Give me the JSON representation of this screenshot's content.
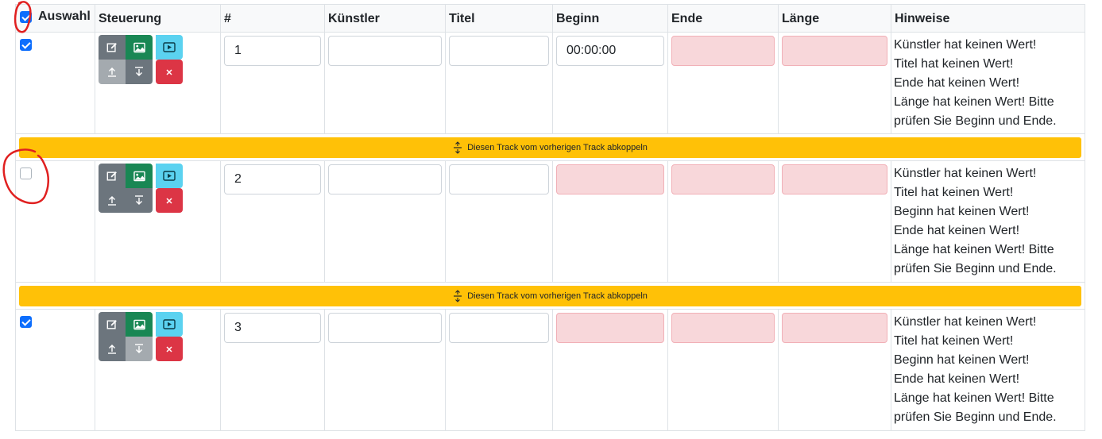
{
  "header": {
    "auswahl": "Auswahl",
    "steuerung": "Steuerung",
    "nummer": "#",
    "kuenstler": "Künstler",
    "titel": "Titel",
    "beginn": "Beginn",
    "ende": "Ende",
    "laenge": "Länge",
    "hinweise": "Hinweise"
  },
  "separator_label": "Diesen Track vom vorherigen Track abkoppeln",
  "tracks": [
    {
      "checked": true,
      "number": "1",
      "kuenstler": "",
      "titel": "",
      "beginn": "00:00:00",
      "ende": "",
      "laenge": "",
      "notes": [
        "Künstler hat keinen Wert!",
        "Titel hat keinen Wert!",
        "Ende hat keinen Wert!",
        "Länge hat keinen Wert! Bitte prüfen Sie Beginn und Ende."
      ]
    },
    {
      "checked": false,
      "number": "2",
      "kuenstler": "",
      "titel": "",
      "beginn": "",
      "ende": "",
      "laenge": "",
      "notes": [
        "Künstler hat keinen Wert!",
        "Titel hat keinen Wert!",
        "Beginn hat keinen Wert!",
        "Ende hat keinen Wert!",
        "Länge hat keinen Wert! Bitte prüfen Sie Beginn und Ende."
      ]
    },
    {
      "checked": true,
      "number": "3",
      "kuenstler": "",
      "titel": "",
      "beginn": "",
      "ende": "",
      "laenge": "",
      "notes": [
        "Künstler hat keinen Wert!",
        "Titel hat keinen Wert!",
        "Beginn hat keinen Wert!",
        "Ende hat keinen Wert!",
        "Länge hat keinen Wert! Bitte prüfen Sie Beginn und Ende."
      ]
    }
  ],
  "icons": {
    "edit": "pencil-square-icon",
    "image": "image-icon",
    "play": "play-icon",
    "up": "arrow-up-icon",
    "down": "arrow-down-icon",
    "delete": "close-icon",
    "separator": "expand-vertical-icon"
  },
  "colors": {
    "primary": "#0d6efd",
    "warning": "#ffc107",
    "danger": "#dc3545",
    "success": "#198754",
    "info": "#5bd2f0",
    "invalid_bg": "#f8d7da",
    "annotation": "#e02020"
  }
}
